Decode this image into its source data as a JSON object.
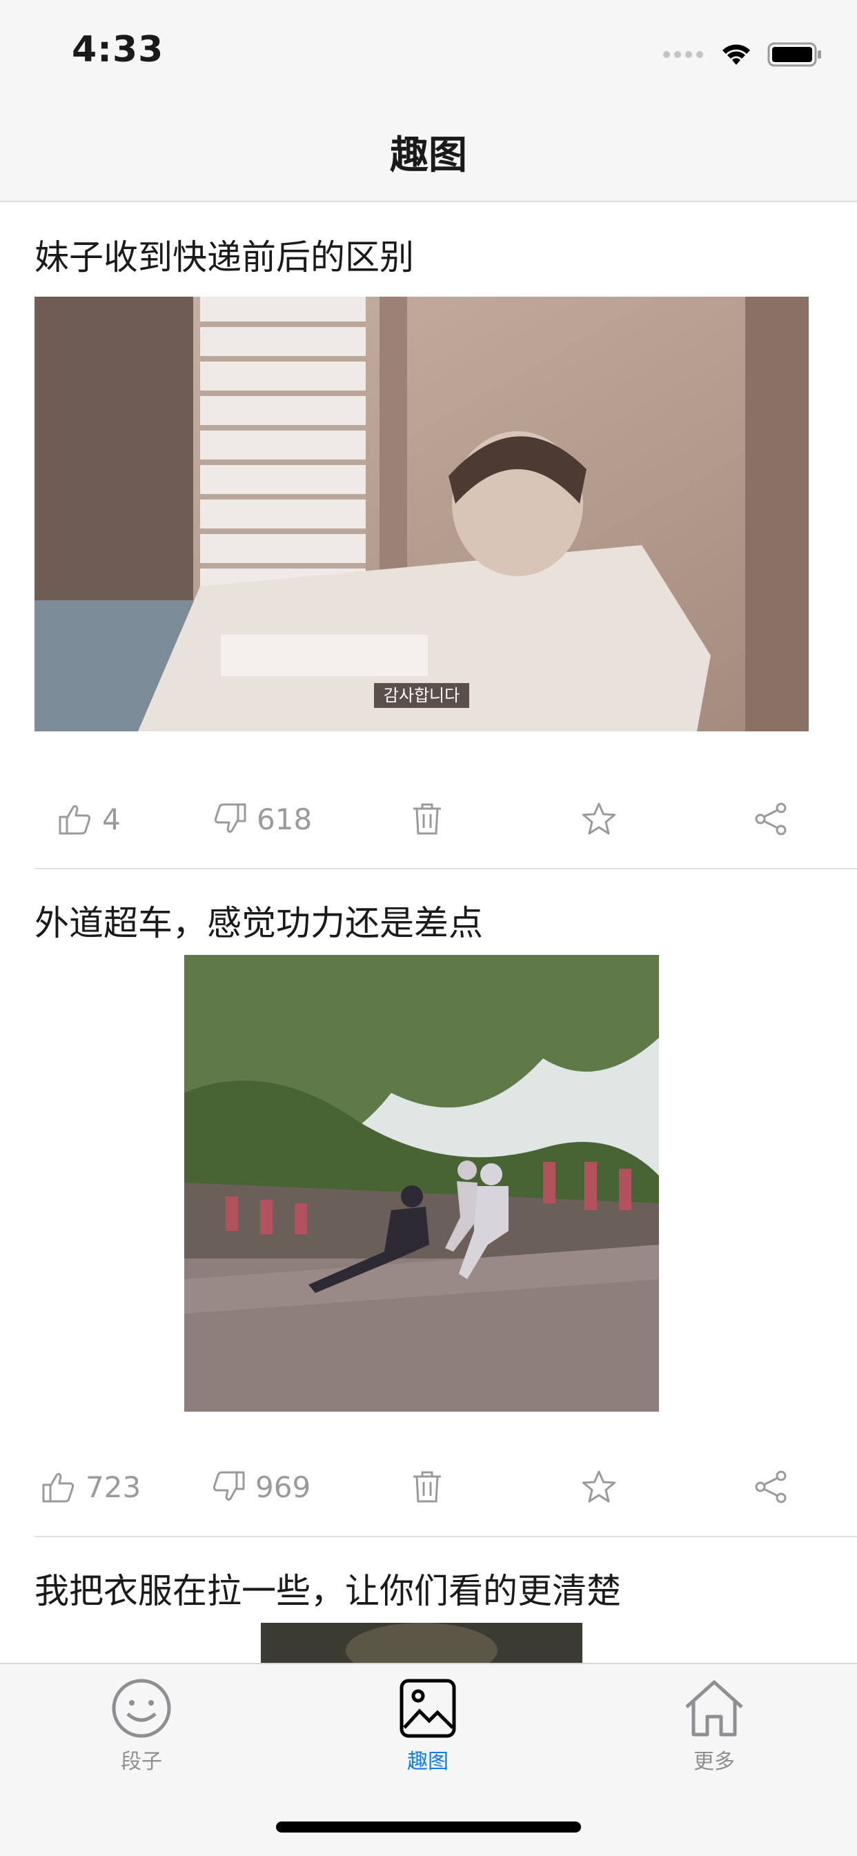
{
  "status_bar": {
    "time": "4:33",
    "icons": [
      "signal-dots-icon",
      "wifi-icon",
      "battery-icon"
    ]
  },
  "nav": {
    "title": "趣图"
  },
  "posts": [
    {
      "title": "妹子收到快递前后的区别",
      "image_caption": "감사합니다",
      "likes": "4",
      "dislikes": "618"
    },
    {
      "title": "外道超车，感觉功力还是差点",
      "likes": "723",
      "dislikes": "969"
    },
    {
      "title": "我把衣服在拉一些，让你们看的更清楚"
    }
  ],
  "tabbar": {
    "items": [
      {
        "label": "段子",
        "icon": "smiley-icon",
        "active": false
      },
      {
        "label": "趣图",
        "icon": "picture-icon",
        "active": true
      },
      {
        "label": "更多",
        "icon": "house-icon",
        "active": false
      }
    ],
    "active_color": "#0b7bff",
    "inactive_color": "#8e8e93"
  },
  "colors": {
    "action_gray": "#9a9a9a",
    "divider": "#e1e1e1"
  }
}
